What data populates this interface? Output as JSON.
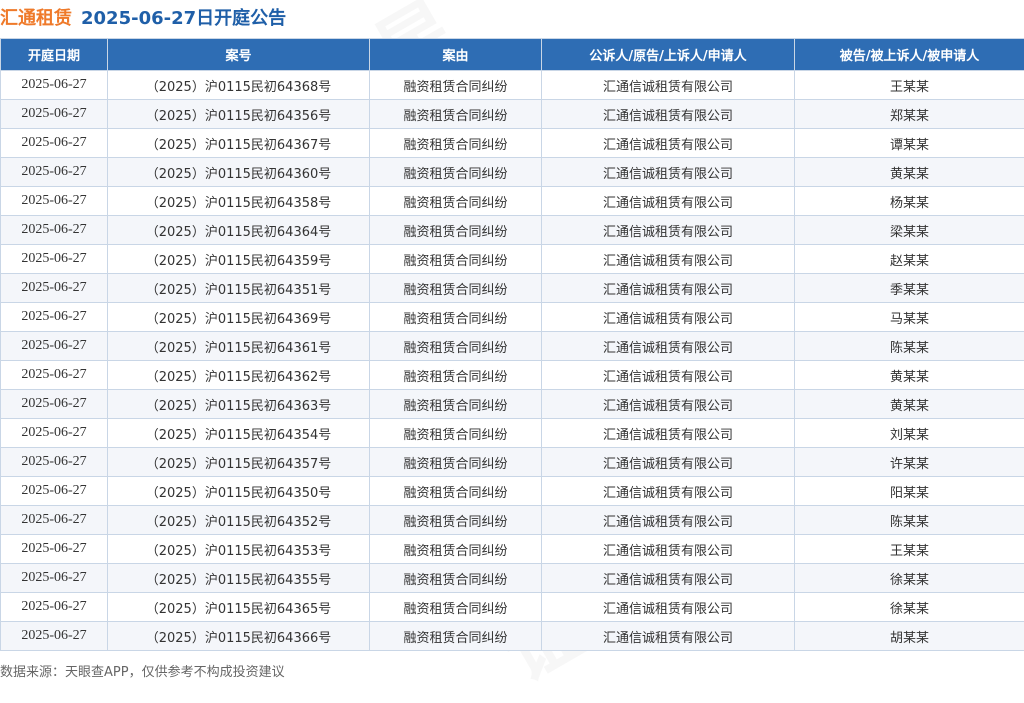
{
  "header": {
    "company": "汇通租赁",
    "title_rest": "2025-06-27日开庭公告"
  },
  "table": {
    "columns": [
      "开庭日期",
      "案号",
      "案由",
      "公诉人/原告/上诉人/申请人",
      "被告/被上诉人/被申请人"
    ],
    "rows": [
      [
        "2025-06-27",
        "（2025）沪0115民初64368号",
        "融资租赁合同纠纷",
        "汇通信诚租赁有限公司",
        "王某某"
      ],
      [
        "2025-06-27",
        "（2025）沪0115民初64356号",
        "融资租赁合同纠纷",
        "汇通信诚租赁有限公司",
        "郑某某"
      ],
      [
        "2025-06-27",
        "（2025）沪0115民初64367号",
        "融资租赁合同纠纷",
        "汇通信诚租赁有限公司",
        "谭某某"
      ],
      [
        "2025-06-27",
        "（2025）沪0115民初64360号",
        "融资租赁合同纠纷",
        "汇通信诚租赁有限公司",
        "黄某某"
      ],
      [
        "2025-06-27",
        "（2025）沪0115民初64358号",
        "融资租赁合同纠纷",
        "汇通信诚租赁有限公司",
        "杨某某"
      ],
      [
        "2025-06-27",
        "（2025）沪0115民初64364号",
        "融资租赁合同纠纷",
        "汇通信诚租赁有限公司",
        "梁某某"
      ],
      [
        "2025-06-27",
        "（2025）沪0115民初64359号",
        "融资租赁合同纠纷",
        "汇通信诚租赁有限公司",
        "赵某某"
      ],
      [
        "2025-06-27",
        "（2025）沪0115民初64351号",
        "融资租赁合同纠纷",
        "汇通信诚租赁有限公司",
        "季某某"
      ],
      [
        "2025-06-27",
        "（2025）沪0115民初64369号",
        "融资租赁合同纠纷",
        "汇通信诚租赁有限公司",
        "马某某"
      ],
      [
        "2025-06-27",
        "（2025）沪0115民初64361号",
        "融资租赁合同纠纷",
        "汇通信诚租赁有限公司",
        "陈某某"
      ],
      [
        "2025-06-27",
        "（2025）沪0115民初64362号",
        "融资租赁合同纠纷",
        "汇通信诚租赁有限公司",
        "黄某某"
      ],
      [
        "2025-06-27",
        "（2025）沪0115民初64363号",
        "融资租赁合同纠纷",
        "汇通信诚租赁有限公司",
        "黄某某"
      ],
      [
        "2025-06-27",
        "（2025）沪0115民初64354号",
        "融资租赁合同纠纷",
        "汇通信诚租赁有限公司",
        "刘某某"
      ],
      [
        "2025-06-27",
        "（2025）沪0115民初64357号",
        "融资租赁合同纠纷",
        "汇通信诚租赁有限公司",
        "许某某"
      ],
      [
        "2025-06-27",
        "（2025）沪0115民初64350号",
        "融资租赁合同纠纷",
        "汇通信诚租赁有限公司",
        "阳某某"
      ],
      [
        "2025-06-27",
        "（2025）沪0115民初64352号",
        "融资租赁合同纠纷",
        "汇通信诚租赁有限公司",
        "陈某某"
      ],
      [
        "2025-06-27",
        "（2025）沪0115民初64353号",
        "融资租赁合同纠纷",
        "汇通信诚租赁有限公司",
        "王某某"
      ],
      [
        "2025-06-27",
        "（2025）沪0115民初64355号",
        "融资租赁合同纠纷",
        "汇通信诚租赁有限公司",
        "徐某某"
      ],
      [
        "2025-06-27",
        "（2025）沪0115民初64365号",
        "融资租赁合同纠纷",
        "汇通信诚租赁有限公司",
        "徐某某"
      ],
      [
        "2025-06-27",
        "（2025）沪0115民初64366号",
        "融资租赁合同纠纷",
        "汇通信诚租赁有限公司",
        "胡某某"
      ]
    ]
  },
  "footer": {
    "source": "数据来源：天眼查APP，仅供参考不构成投资建议"
  },
  "colors": {
    "company_title": "#ef7a2a",
    "date_title": "#1f5fa8",
    "header_bg": "#2e6db4",
    "row_alt_bg": "#f4f6fa",
    "border": "#c9d6e6"
  }
}
